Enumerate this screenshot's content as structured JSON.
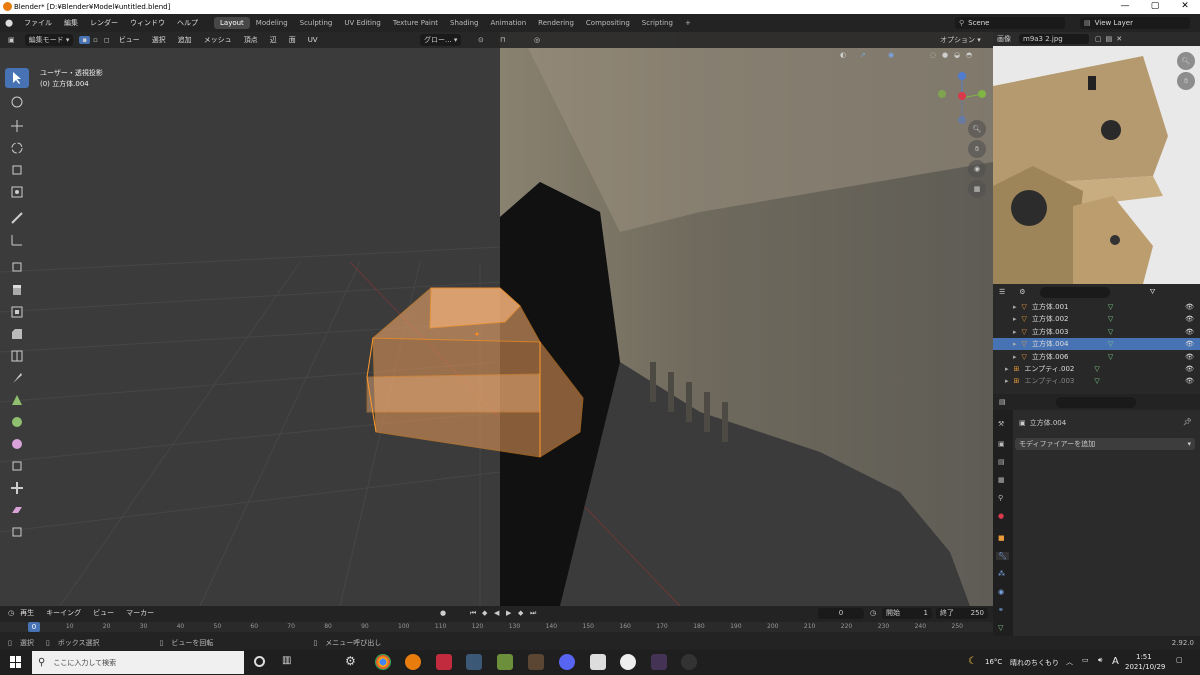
{
  "window": {
    "title": "Blender* [D:¥Blender¥Model¥untitled.blend]"
  },
  "menus": [
    "ファイル",
    "編集",
    "レンダー",
    "ウィンドウ",
    "ヘルプ"
  ],
  "workspaces": [
    "Layout",
    "Modeling",
    "Sculpting",
    "UV Editing",
    "Texture Paint",
    "Shading",
    "Animation",
    "Rendering",
    "Compositing",
    "Scripting"
  ],
  "active_workspace": "Layout",
  "scene": {
    "name": "Scene",
    "view_layer": "View Layer"
  },
  "viewport": {
    "mode": "編集モード",
    "menu": [
      "ビュー",
      "選択",
      "追加",
      "メッシュ",
      "頂点",
      "辺",
      "面",
      "UV"
    ],
    "view_name": "ユーザー・透視投影",
    "object_name": "(0) 立方体.004",
    "transform": "グロー...",
    "options": "オプション"
  },
  "image_editor": {
    "label": "画像",
    "file": "m9a3 2.jpg"
  },
  "outliner": {
    "items": [
      {
        "name": "立方体.001",
        "kind": "mesh",
        "selected": false
      },
      {
        "name": "立方体.002",
        "kind": "mesh",
        "selected": false
      },
      {
        "name": "立方体.003",
        "kind": "mesh",
        "selected": false
      },
      {
        "name": "立方体.004",
        "kind": "mesh",
        "selected": true
      },
      {
        "name": "立方体.006",
        "kind": "mesh",
        "selected": false
      },
      {
        "name": "エンプティ.002",
        "kind": "empty",
        "selected": false
      },
      {
        "name": "エンプティ.003",
        "kind": "empty",
        "selected": false
      }
    ]
  },
  "properties": {
    "object": "立方体.004",
    "add_modifier": "モディファイアーを追加"
  },
  "timeline": {
    "menus": [
      "再生",
      "キーイング",
      "ビュー",
      "マーカー"
    ],
    "current_frame": "0",
    "start_label": "開始",
    "start": "1",
    "end_label": "終了",
    "end": "250",
    "ticks": [
      "0",
      "10",
      "20",
      "30",
      "40",
      "50",
      "60",
      "70",
      "80",
      "90",
      "100",
      "110",
      "120",
      "130",
      "140",
      "150",
      "160",
      "170",
      "180",
      "190",
      "200",
      "210",
      "220",
      "230",
      "240",
      "250"
    ]
  },
  "status": {
    "select": "選択",
    "box": "ボックス選択",
    "rotate": "ビューを回転",
    "menu": "メニュー呼び出し",
    "version": "2.92.0"
  },
  "taskbar": {
    "search": "ここに入力して検索",
    "weather_temp": "16°C",
    "weather_desc": "晴れのちくもり",
    "ime": "A",
    "time": "1:51",
    "date": "2021/10/29"
  },
  "colors": {
    "accent": "#4772b3",
    "mesh": "#f0a050",
    "orange_select": "#ff8c1a",
    "bg": "#393939"
  }
}
